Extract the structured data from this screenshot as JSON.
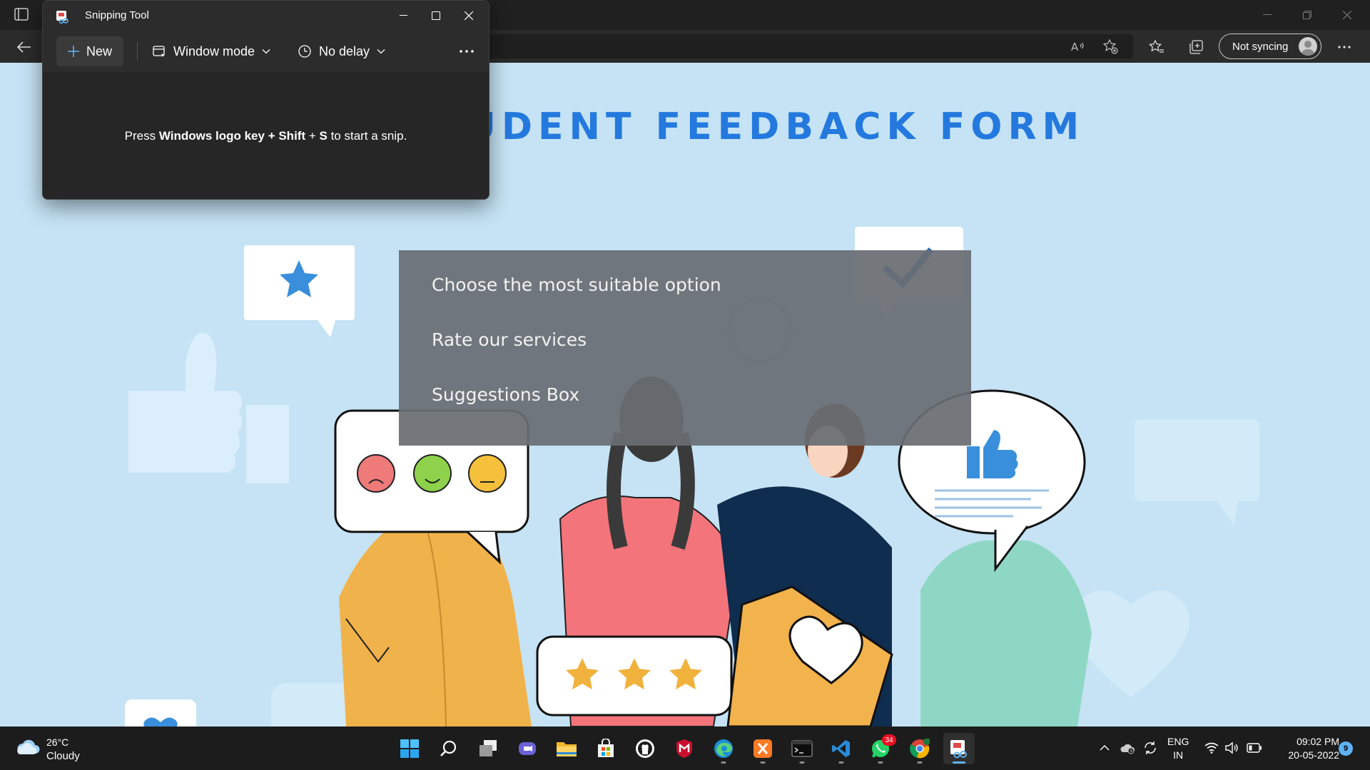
{
  "snipping_tool": {
    "title": "Snipping Tool",
    "new_label": "New",
    "mode_label": "Window mode",
    "delay_label": "No delay",
    "hint_prefix": "Press ",
    "hint_key1": "Windows logo key",
    "hint_plus1": " + ",
    "hint_key2": "Shift",
    "hint_plus2": " + ",
    "hint_key3": "S",
    "hint_suffix": " to start a snip."
  },
  "browser": {
    "profile_label": "Not syncing"
  },
  "page": {
    "title": "STUDENT FEEDBACK FORM",
    "menu": [
      "Choose the most suitable option",
      "Rate our services",
      "Suggestions Box"
    ]
  },
  "taskbar": {
    "weather_temp": "26°C",
    "weather_desc": "Cloudy",
    "whatsapp_badge": "34",
    "lang_line1": "ENG",
    "lang_line2": "IN",
    "time": "09:02 PM",
    "date": "20-05-2022",
    "notification_count": "9"
  },
  "colors": {
    "title_blue": "#2479de",
    "page_bg": "#c5e3f4",
    "menu_overlay": "#696e73",
    "accent": "#5fb2f2"
  }
}
